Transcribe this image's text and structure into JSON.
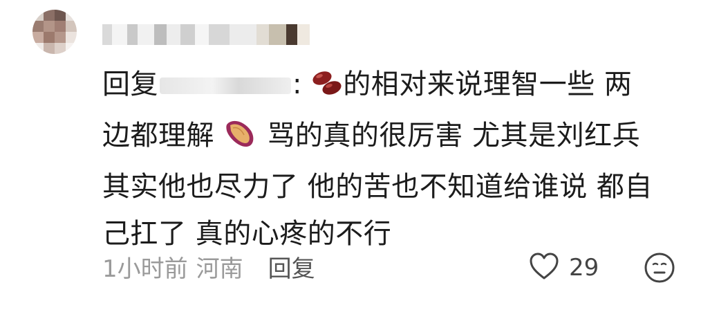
{
  "comment": {
    "prefix": "回复",
    "after_name": ":",
    "text_line1_part": "的相对来说理智一些 两",
    "text_line2_a": "边都理解",
    "text_line2_b": "骂的真的很厉害 尤其是刘红兵",
    "text_line3": "其实他也尽力了 他的苦也不知道给谁说 都自",
    "text_line4": "己扛了 真的心疼的不行",
    "emojis": [
      "beans-emoji",
      "sweet-potato-emoji"
    ]
  },
  "meta": {
    "time": "1小时前",
    "location": "河南",
    "reply_label": "回复"
  },
  "actions": {
    "like_count": "29",
    "like_icon": "heart-outline-icon",
    "dislike_icon": "neutral-face-icon"
  },
  "colors": {
    "text": "#1c1c1c",
    "meta": "#9a9a9a",
    "icon": "#444444"
  }
}
